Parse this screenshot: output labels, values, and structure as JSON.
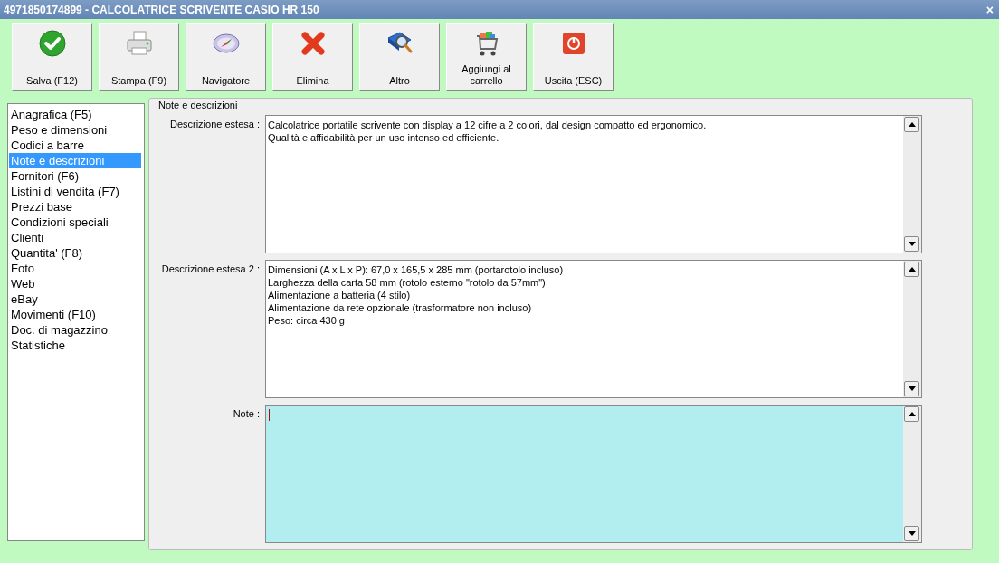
{
  "window": {
    "title": "4971850174899 - CALCOLATRICE SCRIVENTE CASIO HR 150",
    "close": "×"
  },
  "toolbar": [
    {
      "label": "Salva (F12)"
    },
    {
      "label": "Stampa (F9)"
    },
    {
      "label": "Navigatore"
    },
    {
      "label": "Elimina"
    },
    {
      "label": "Altro"
    },
    {
      "label": "Aggiungi al carrello"
    },
    {
      "label": "Uscita (ESC)"
    }
  ],
  "sidebar": {
    "items": [
      {
        "label": "Anagrafica (F5)",
        "selected": false
      },
      {
        "label": "Peso e dimensioni",
        "selected": false
      },
      {
        "label": "Codici a barre",
        "selected": false
      },
      {
        "label": "Note e descrizioni",
        "selected": true
      },
      {
        "label": "Fornitori (F6)",
        "selected": false
      },
      {
        "label": "Listini di vendita (F7)",
        "selected": false
      },
      {
        "label": "Prezzi base",
        "selected": false
      },
      {
        "label": "Condizioni speciali",
        "selected": false
      },
      {
        "label": "Clienti",
        "selected": false
      },
      {
        "label": "Quantita' (F8)",
        "selected": false
      },
      {
        "label": "Foto",
        "selected": false
      },
      {
        "label": "Web",
        "selected": false
      },
      {
        "label": "eBay",
        "selected": false
      },
      {
        "label": "Movimenti (F10)",
        "selected": false
      },
      {
        "label": "Doc. di magazzino",
        "selected": false
      },
      {
        "label": "Statistiche",
        "selected": false
      }
    ]
  },
  "group": {
    "title": "Note e descrizioni",
    "fields": [
      {
        "label": "Descrizione estesa :",
        "focused": false,
        "lines": [
          "Calcolatrice portatile scrivente con display a 12 cifre a 2 colori, dal design compatto ed ergonomico.",
          "Qualità e affidabilità per un uso intenso ed efficiente."
        ]
      },
      {
        "label": "Descrizione estesa 2 :",
        "focused": false,
        "lines": [
          "Dimensioni (A x L x P): 67,0 x 165,5 x 285 mm (portarotolo incluso)",
          "Larghezza della carta 58 mm (rotolo esterno \"rotolo da 57mm\")",
          "Alimentazione a batteria (4 stilo)",
          "Alimentazione da rete opzionale (trasformatore non incluso)",
          "Peso: circa 430 g"
        ]
      },
      {
        "label": "Note :",
        "focused": true
      }
    ]
  }
}
